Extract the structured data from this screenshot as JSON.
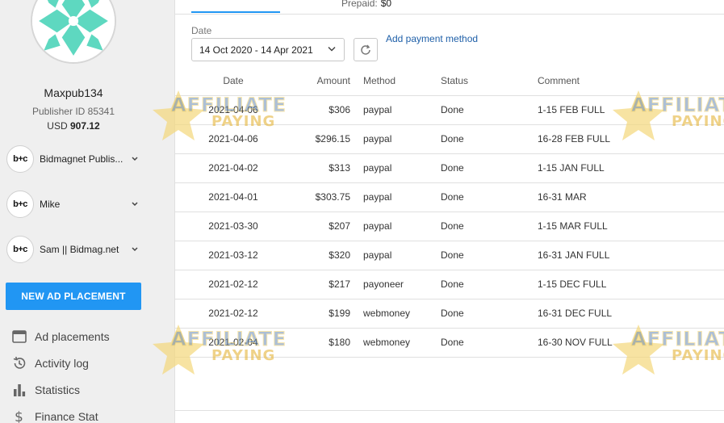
{
  "profile": {
    "username": "Maxpub134",
    "publisher_id": "Publisher ID 85341",
    "currency": "USD",
    "balance": "907.12"
  },
  "accounts": [
    {
      "logo_text": "b+c",
      "name": "Bidmagnet Publis..."
    },
    {
      "logo_text": "b+c",
      "name": "Mike"
    },
    {
      "logo_text": "b+c",
      "name": "Sam || Bidmag.net"
    }
  ],
  "new_placement_label": "NEW AD PLACEMENT",
  "nav": [
    {
      "label": "Ad placements",
      "icon": "placements-icon"
    },
    {
      "label": "Activity log",
      "icon": "history-icon"
    },
    {
      "label": "Statistics",
      "icon": "bar-chart-icon"
    },
    {
      "label": "Finance Stat",
      "icon": "dollar-icon"
    }
  ],
  "header": {
    "prepaid_label": "Prepaid:",
    "prepaid_value": "$0"
  },
  "filter": {
    "date_label": "Date",
    "date_range": "14 Oct 2020 - 14 Apr 2021",
    "add_payment_label": "Add payment method"
  },
  "table": {
    "columns": [
      "Date",
      "Amount",
      "Method",
      "Status",
      "Comment"
    ],
    "rows": [
      [
        "2021-04-06",
        "$306",
        "paypal",
        "Done",
        "1-15 FEB FULL"
      ],
      [
        "2021-04-06",
        "$296.15",
        "paypal",
        "Done",
        "16-28 FEB FULL"
      ],
      [
        "2021-04-02",
        "$313",
        "paypal",
        "Done",
        "1-15 JAN FULL"
      ],
      [
        "2021-04-01",
        "$303.75",
        "paypal",
        "Done",
        "16-31 MAR"
      ],
      [
        "2021-03-30",
        "$207",
        "paypal",
        "Done",
        "1-15 MAR FULL"
      ],
      [
        "2021-03-12",
        "$320",
        "paypal",
        "Done",
        "16-31 JAN FULL"
      ],
      [
        "2021-02-12",
        "$217",
        "payoneer",
        "Done",
        "1-15 DEC FULL"
      ],
      [
        "2021-02-12",
        "$199",
        "webmoney",
        "Done",
        "16-31 DEC FULL"
      ],
      [
        "2021-02-04",
        "$180",
        "webmoney",
        "Done",
        "16-30 NOV FULL"
      ]
    ]
  },
  "watermark": {
    "line1": "AFFILIATE",
    "line2": "PAYING"
  },
  "colors": {
    "accent": "#2196f3",
    "link": "#1e5fa8",
    "sidebar_bg": "#efefef",
    "avatar_pattern": "#5ed8c0"
  }
}
